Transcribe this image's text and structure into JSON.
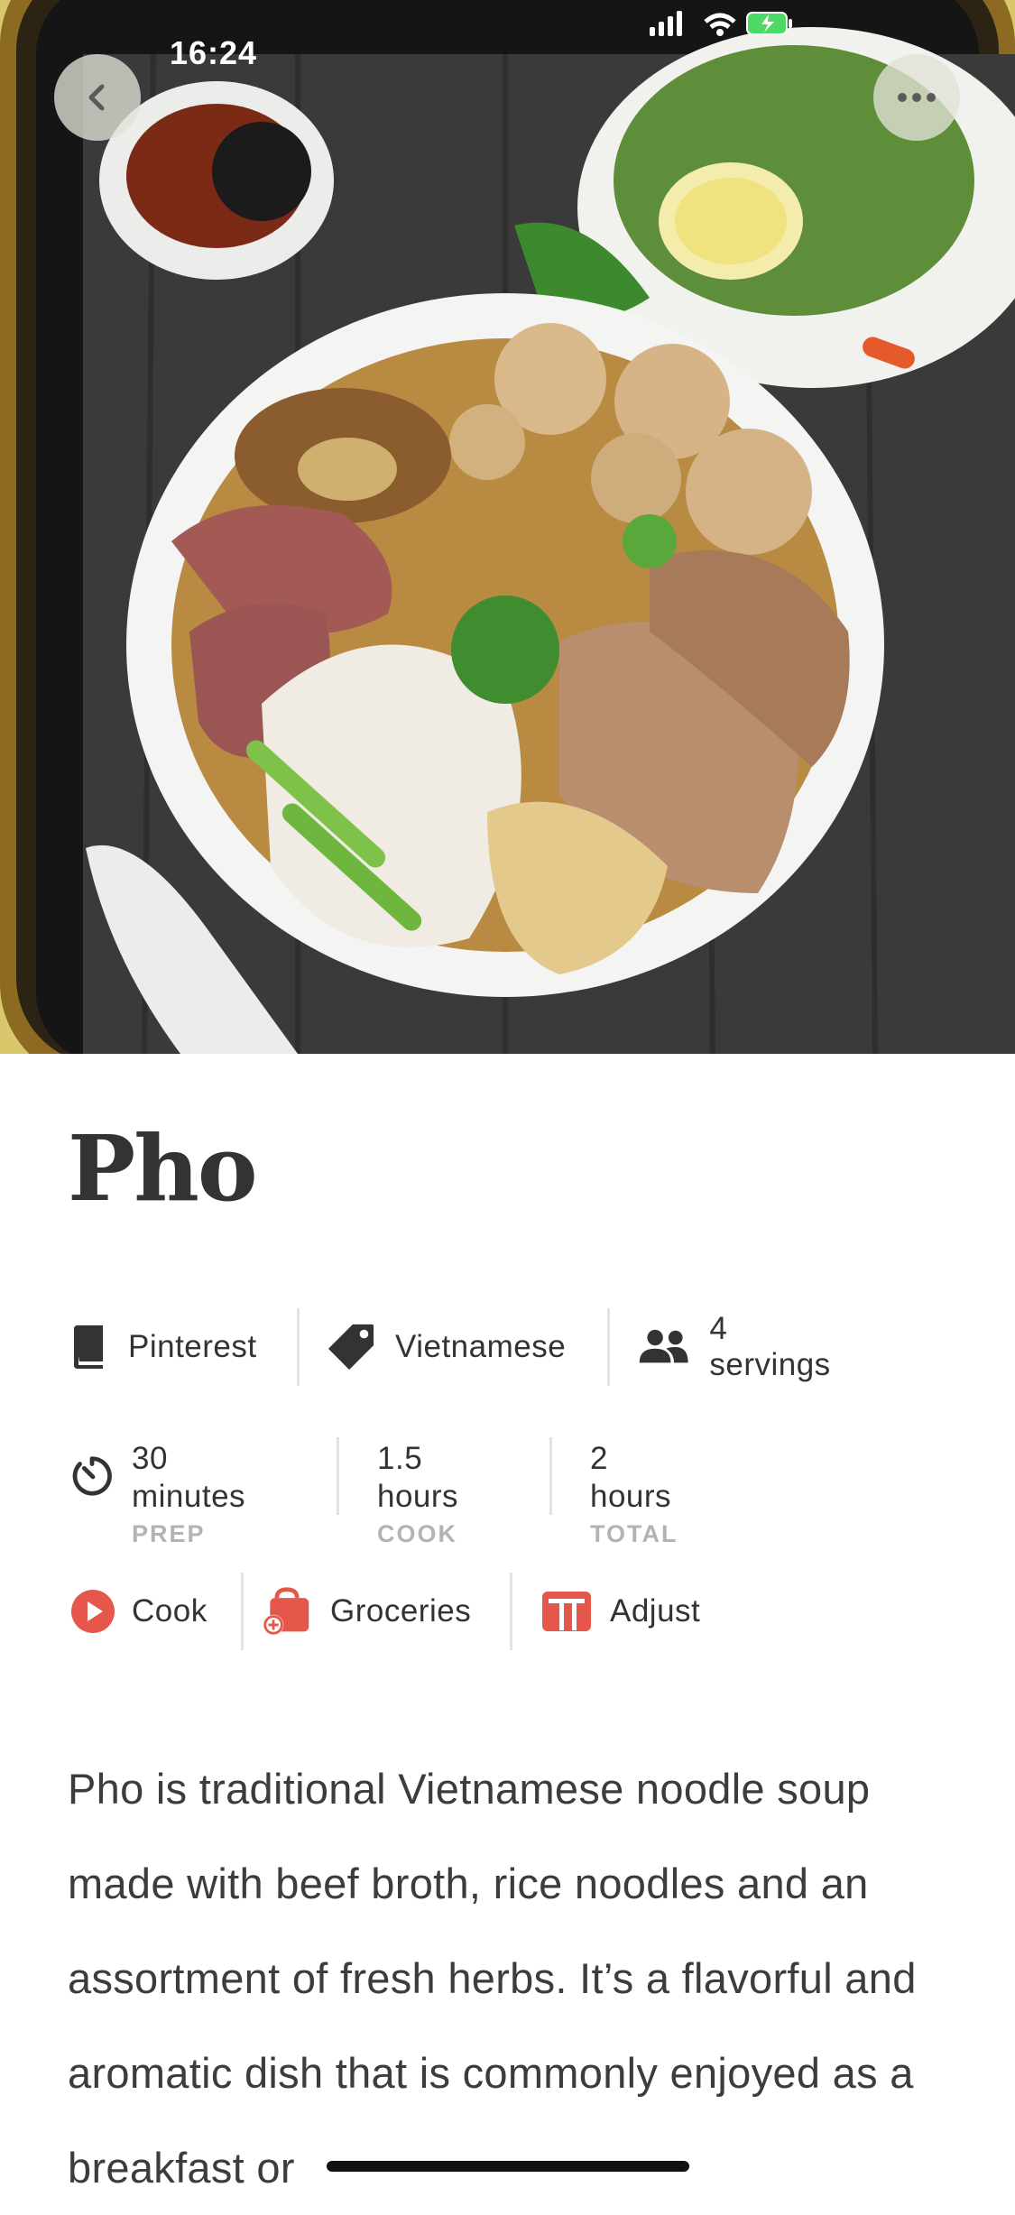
{
  "status_bar": {
    "time": "16:24"
  },
  "recipe": {
    "title": "Pho",
    "source": "Pinterest",
    "cuisine": "Vietnamese",
    "servings": "4 servings",
    "times": [
      {
        "value": "30 minutes",
        "label": "PREP"
      },
      {
        "value": "1.5 hours",
        "label": "COOK"
      },
      {
        "value": "2 hours",
        "label": "TOTAL"
      }
    ],
    "actions": {
      "cook": "Cook",
      "groceries": "Groceries",
      "adjust": "Adjust"
    },
    "description": "Pho is traditional Vietnamese noodle soup made with beef broth, rice noodles and an assortment of fresh herbs. It’s a flavorful and aromatic dish that is commonly enjoyed as a breakfast or"
  },
  "icons": {
    "back": "chevron-left-icon",
    "more": "ellipsis-icon",
    "source": "book-icon",
    "cuisine": "tag-icon",
    "servings": "people-icon",
    "timer": "timer-icon",
    "cook": "play-icon",
    "groceries": "shopping-bag-icon",
    "adjust": "adjust-icon"
  },
  "colors": {
    "accent": "#e4574a",
    "text": "#333333",
    "muted": "#b3b3b3"
  }
}
